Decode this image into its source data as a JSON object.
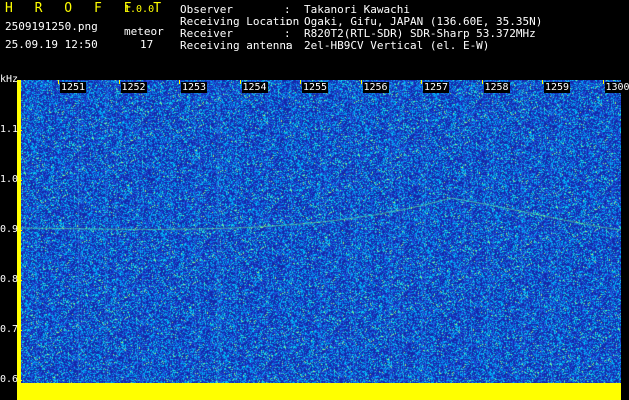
{
  "header": {
    "app_title": "H R O F F T",
    "version": "1.0.0",
    "filename": "2509191250.png",
    "meteor_label": "meteor",
    "datetime": "25.09.19 12:50",
    "meteor_count": "17"
  },
  "info": [
    {
      "key": "Observer",
      "value": "Takanori Kawachi"
    },
    {
      "key": "Receiving Location",
      "value": "Ogaki, Gifu, JAPAN (136.60E, 35.35N)"
    },
    {
      "key": "Receiver",
      "value": "R820T2(RTL-SDR) SDR-Sharp 53.372MHz"
    },
    {
      "key": "Receiving antenna",
      "value": "2el-HB9CV Vertical (el. E-W)"
    }
  ],
  "chart_data": {
    "type": "heatmap",
    "ylabel": "kHz",
    "y_ticks": [
      "1.1",
      "1.0",
      "0.9",
      "0.8",
      "0.7",
      "0.6"
    ],
    "y_range": [
      0.6,
      1.1
    ],
    "x_ticks": [
      "1251",
      "1252",
      "1253",
      "1254",
      "1255",
      "1256",
      "1257",
      "1258",
      "1259",
      "1300"
    ],
    "colors": {
      "background": "#1a2fb8",
      "noise_high": "#00c8ff",
      "signal": "#00ff80",
      "axis": "#ffff00"
    }
  }
}
